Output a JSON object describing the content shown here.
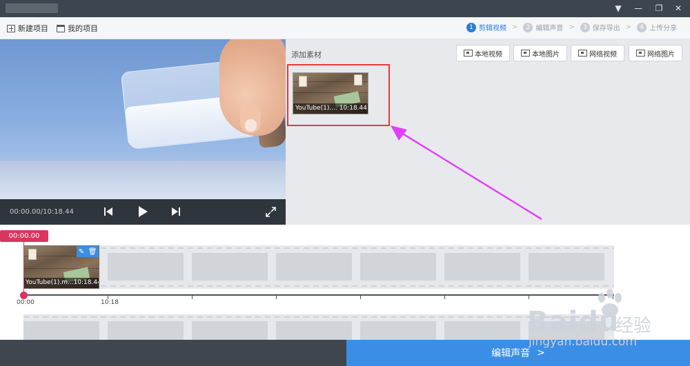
{
  "window": {
    "controls": [
      "▼",
      "—",
      "❐",
      "✕"
    ]
  },
  "toolbar": {
    "new_project": "新建项目",
    "my_projects": "我的项目",
    "steps": [
      {
        "num": "1",
        "label": "剪辑视频",
        "active": true
      },
      {
        "num": "2",
        "label": "编辑声音",
        "active": false
      },
      {
        "num": "3",
        "label": "保存导出",
        "active": false
      },
      {
        "num": "4",
        "label": "上传分享",
        "active": false
      }
    ]
  },
  "preview": {
    "time": "00:00.00/10:18.44"
  },
  "material": {
    "title": "添加素材",
    "buttons": [
      "本地视频",
      "本地图片",
      "网络视频",
      "网络图片"
    ],
    "item": {
      "name": "YouTube(1)....",
      "duration": "10:18.44"
    }
  },
  "timeline": {
    "playhead_time": "00:00.00",
    "clip": {
      "name": "YouTube(1).m...",
      "duration": "10:18.44"
    },
    "ruler_labels": [
      "00:00",
      "10:18"
    ]
  },
  "bottom": {
    "next_label": "编辑声音"
  },
  "watermark": {
    "brand": "Baidu",
    "brand_cn": "经验",
    "url": "jingyan.baidu.com"
  },
  "colors": {
    "accent": "#3a8ee6",
    "playhead": "#d9365f",
    "highlight_box": "#e53935",
    "annotation_arrow": "#e040fb"
  }
}
